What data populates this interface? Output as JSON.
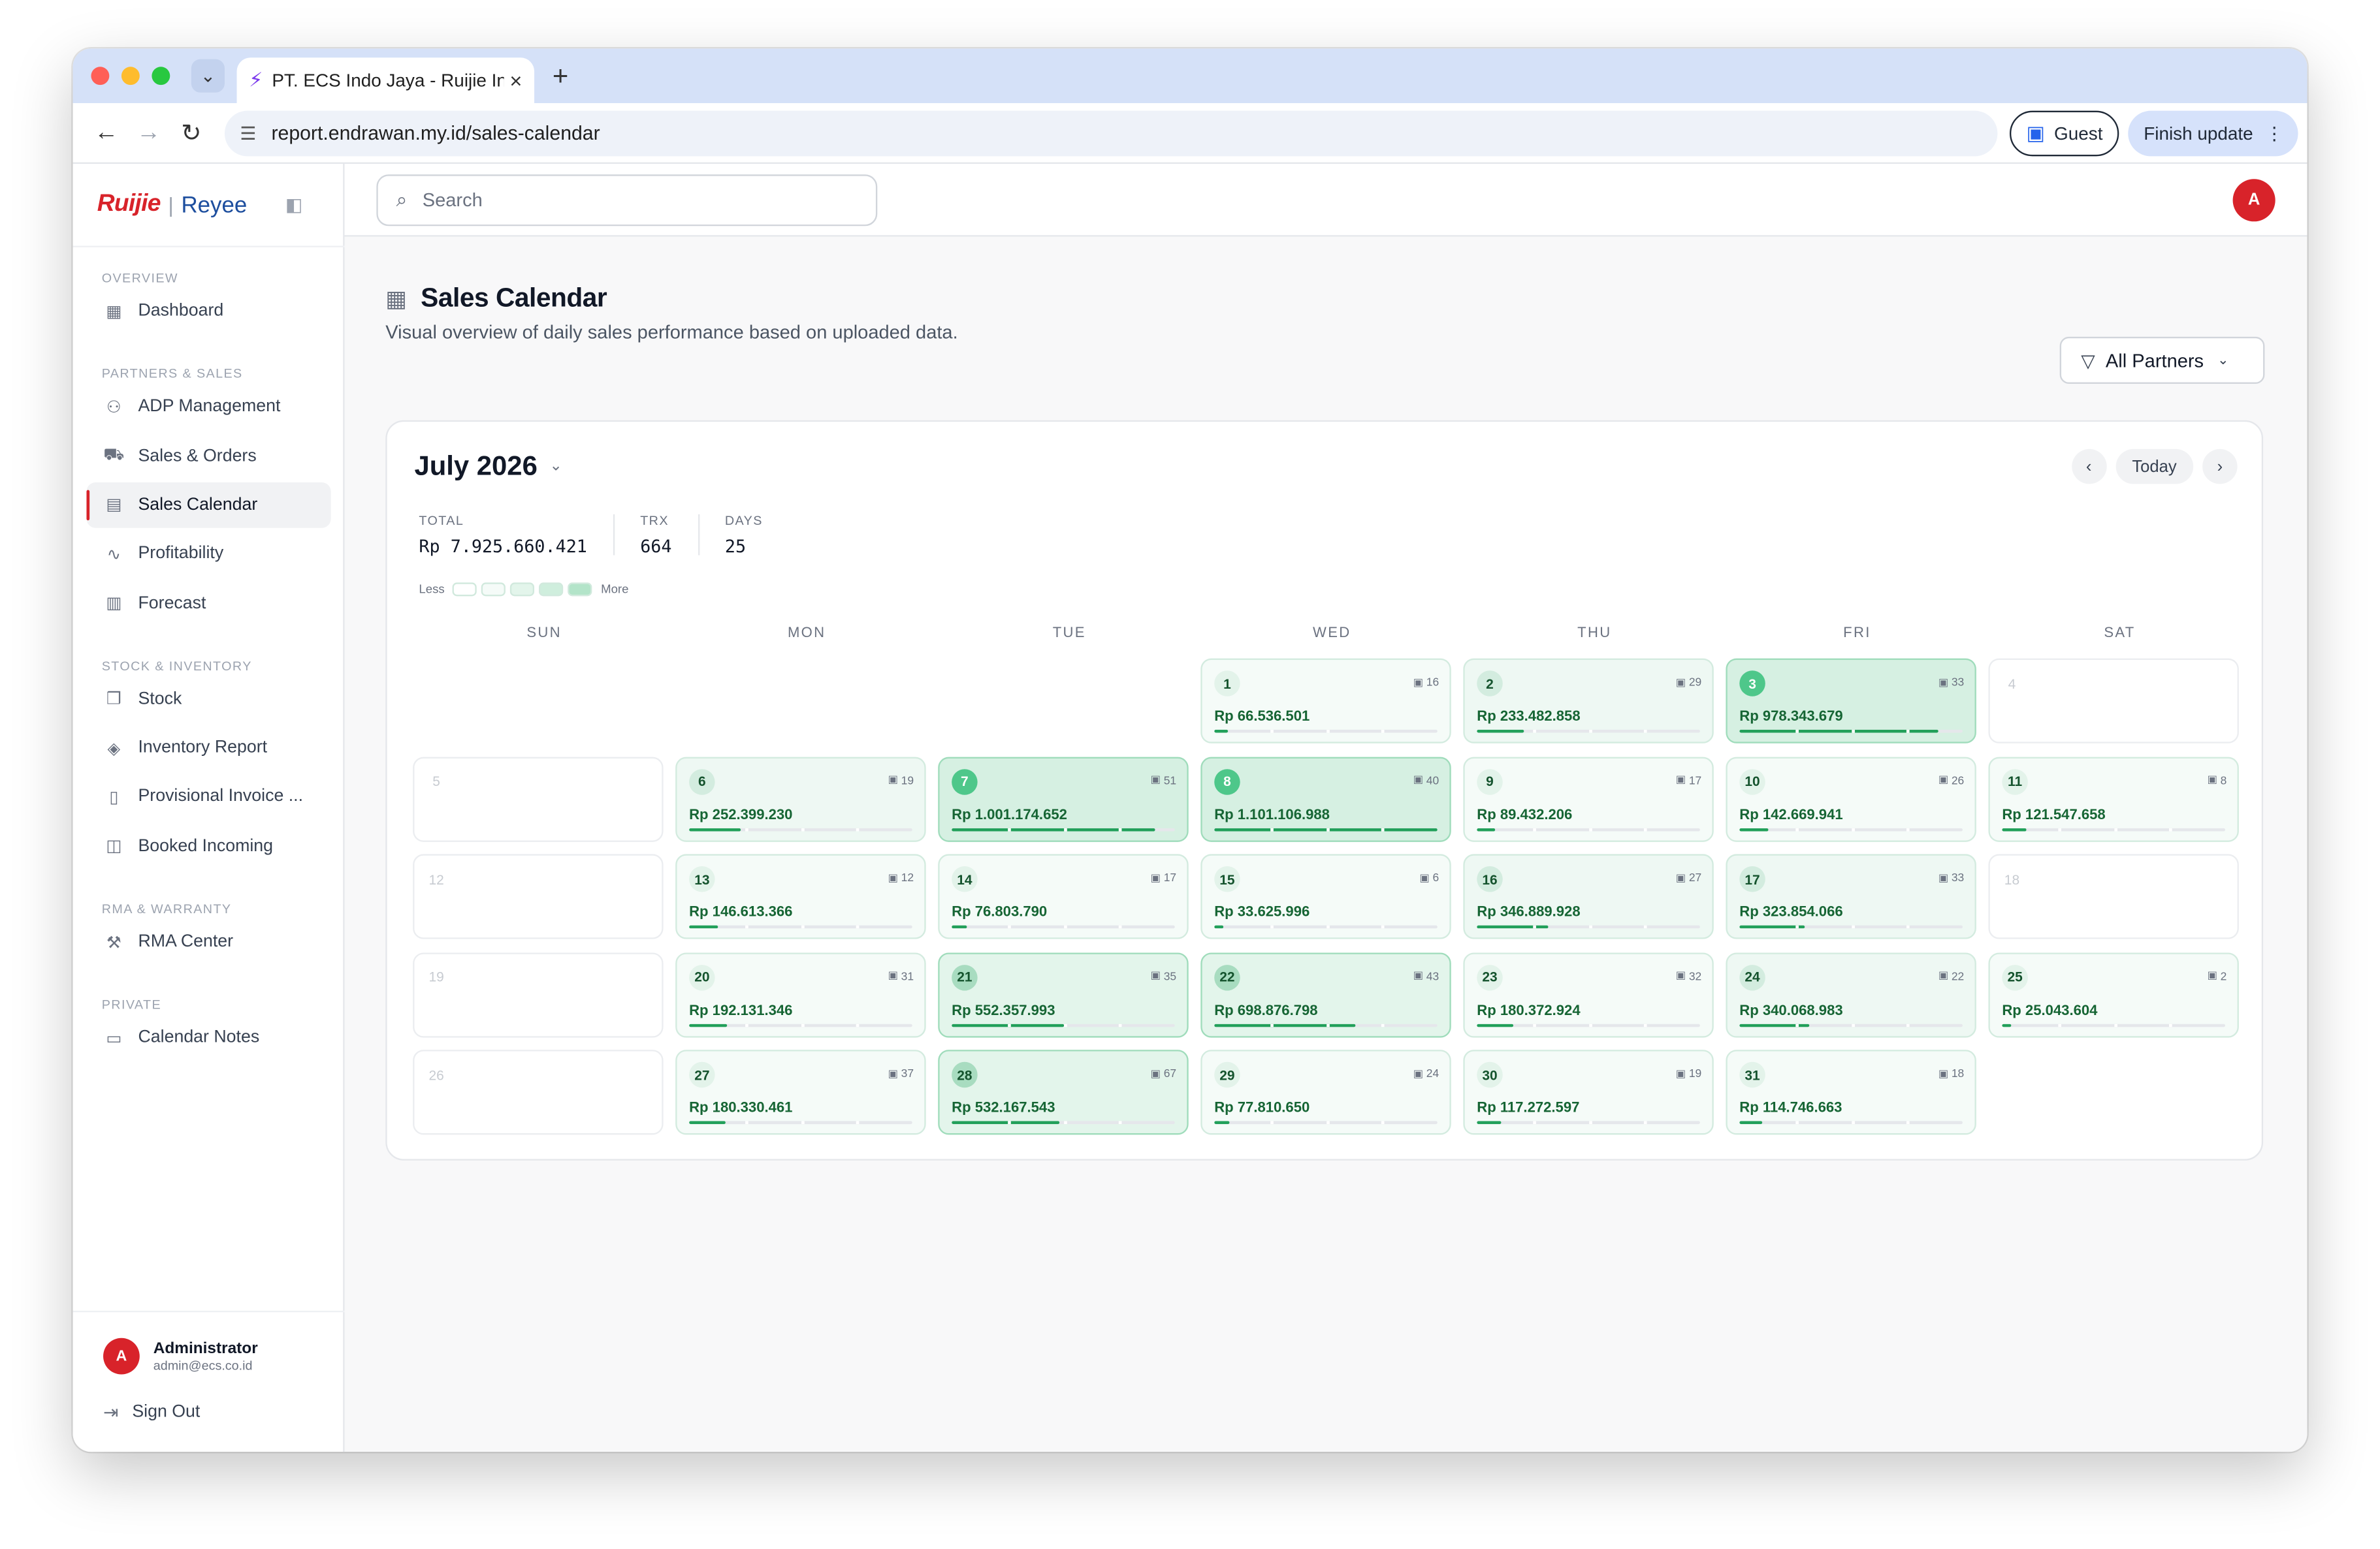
{
  "browser": {
    "tab_title": "PT. ECS Indo Jaya - Ruijie Inte",
    "url": "report.endrawan.my.id/sales-calendar",
    "guest_label": "Guest",
    "finish_update_label": "Finish update"
  },
  "sidebar": {
    "brand_ruijie": "Ruijie",
    "brand_separator": "|",
    "brand_reyee": "Reyee",
    "sections": [
      {
        "title": "OVERVIEW",
        "items": [
          {
            "label": "Dashboard",
            "icon": "grid-icon"
          }
        ]
      },
      {
        "title": "PARTNERS & SALES",
        "items": [
          {
            "label": "ADP Management",
            "icon": "users-icon"
          },
          {
            "label": "Sales & Orders",
            "icon": "cart-icon"
          },
          {
            "label": "Sales Calendar",
            "icon": "calendar-icon",
            "active": true
          },
          {
            "label": "Profitability",
            "icon": "activity-icon"
          },
          {
            "label": "Forecast",
            "icon": "bar-chart-icon"
          }
        ]
      },
      {
        "title": "STOCK & INVENTORY",
        "items": [
          {
            "label": "Stock",
            "icon": "package-icon"
          },
          {
            "label": "Inventory Report",
            "icon": "tag-icon"
          },
          {
            "label": "Provisional Invoice ...",
            "icon": "document-icon"
          },
          {
            "label": "Booked Incoming",
            "icon": "bookmark-icon"
          }
        ]
      },
      {
        "title": "RMA & WARRANTY",
        "items": [
          {
            "label": "RMA Center",
            "icon": "wrench-icon"
          }
        ]
      },
      {
        "title": "PRIVATE",
        "items": [
          {
            "label": "Calendar Notes",
            "icon": "file-icon"
          }
        ]
      }
    ],
    "user": {
      "initial": "A",
      "name": "Administrator",
      "email": "admin@ecs.co.id"
    },
    "sign_out_label": "Sign Out"
  },
  "topbar": {
    "search_placeholder": "Search",
    "avatar_initial": "A"
  },
  "page": {
    "title": "Sales Calendar",
    "subtitle": "Visual overview of daily sales performance based on uploaded data.",
    "filter_label": "All Partners"
  },
  "calendar": {
    "month_label": "July 2026",
    "today_label": "Today",
    "stats": {
      "total_label": "TOTAL",
      "total_value": "Rp 7.925.660.421",
      "trx_label": "TRX",
      "trx_value": "664",
      "days_label": "DAYS",
      "days_value": "25"
    },
    "legend": {
      "less": "Less",
      "more": "More"
    },
    "weekdays": [
      "SUN",
      "MON",
      "TUE",
      "WED",
      "THU",
      "FRI",
      "SAT"
    ],
    "first_weekday_index": 3,
    "colors": {
      "accent": "#22a05a",
      "level_bg": [
        "#f5fbf8",
        "#eef8f3",
        "#e3f5eb",
        "#d6f0e2"
      ],
      "level_badge": [
        "#e3f3ea",
        "#d3ecdf",
        "#a8dcc0",
        "#4ec78a"
      ]
    },
    "days": [
      {
        "day": "1",
        "amount": "Rp 66.536.501",
        "trx": "16",
        "ratio": 0.06
      },
      {
        "day": "2",
        "amount": "Rp 233.482.858",
        "trx": "29",
        "ratio": 0.21
      },
      {
        "day": "3",
        "amount": "Rp 978.343.679",
        "trx": "33",
        "ratio": 0.89
      },
      {
        "day": "4"
      },
      {
        "day": "5"
      },
      {
        "day": "6",
        "amount": "Rp 252.399.230",
        "trx": "19",
        "ratio": 0.23
      },
      {
        "day": "7",
        "amount": "Rp 1.001.174.652",
        "trx": "51",
        "ratio": 0.91
      },
      {
        "day": "8",
        "amount": "Rp 1.101.106.988",
        "trx": "40",
        "ratio": 1.0
      },
      {
        "day": "9",
        "amount": "Rp 89.432.206",
        "trx": "17",
        "ratio": 0.08
      },
      {
        "day": "10",
        "amount": "Rp 142.669.941",
        "trx": "26",
        "ratio": 0.13
      },
      {
        "day": "11",
        "amount": "Rp 121.547.658",
        "trx": "8",
        "ratio": 0.11
      },
      {
        "day": "12"
      },
      {
        "day": "13",
        "amount": "Rp 146.613.366",
        "trx": "12",
        "ratio": 0.13
      },
      {
        "day": "14",
        "amount": "Rp 76.803.790",
        "trx": "17",
        "ratio": 0.07
      },
      {
        "day": "15",
        "amount": "Rp 33.625.996",
        "trx": "6",
        "ratio": 0.03
      },
      {
        "day": "16",
        "amount": "Rp 346.889.928",
        "trx": "27",
        "ratio": 0.32
      },
      {
        "day": "17",
        "amount": "Rp 323.854.066",
        "trx": "33",
        "ratio": 0.29
      },
      {
        "day": "18"
      },
      {
        "day": "19"
      },
      {
        "day": "20",
        "amount": "Rp 192.131.346",
        "trx": "31",
        "ratio": 0.17
      },
      {
        "day": "21",
        "amount": "Rp 552.357.993",
        "trx": "35",
        "ratio": 0.5
      },
      {
        "day": "22",
        "amount": "Rp 698.876.798",
        "trx": "43",
        "ratio": 0.63
      },
      {
        "day": "23",
        "amount": "Rp 180.372.924",
        "trx": "32",
        "ratio": 0.16
      },
      {
        "day": "24",
        "amount": "Rp 340.068.983",
        "trx": "22",
        "ratio": 0.31
      },
      {
        "day": "25",
        "amount": "Rp 25.043.604",
        "trx": "2",
        "ratio": 0.02
      },
      {
        "day": "26"
      },
      {
        "day": "27",
        "amount": "Rp 180.330.461",
        "trx": "37",
        "ratio": 0.16
      },
      {
        "day": "28",
        "amount": "Rp 532.167.543",
        "trx": "67",
        "ratio": 0.48
      },
      {
        "day": "29",
        "amount": "Rp 77.810.650",
        "trx": "24",
        "ratio": 0.07
      },
      {
        "day": "30",
        "amount": "Rp 117.272.597",
        "trx": "19",
        "ratio": 0.11
      },
      {
        "day": "31",
        "amount": "Rp 114.746.663",
        "trx": "18",
        "ratio": 0.1
      }
    ]
  }
}
